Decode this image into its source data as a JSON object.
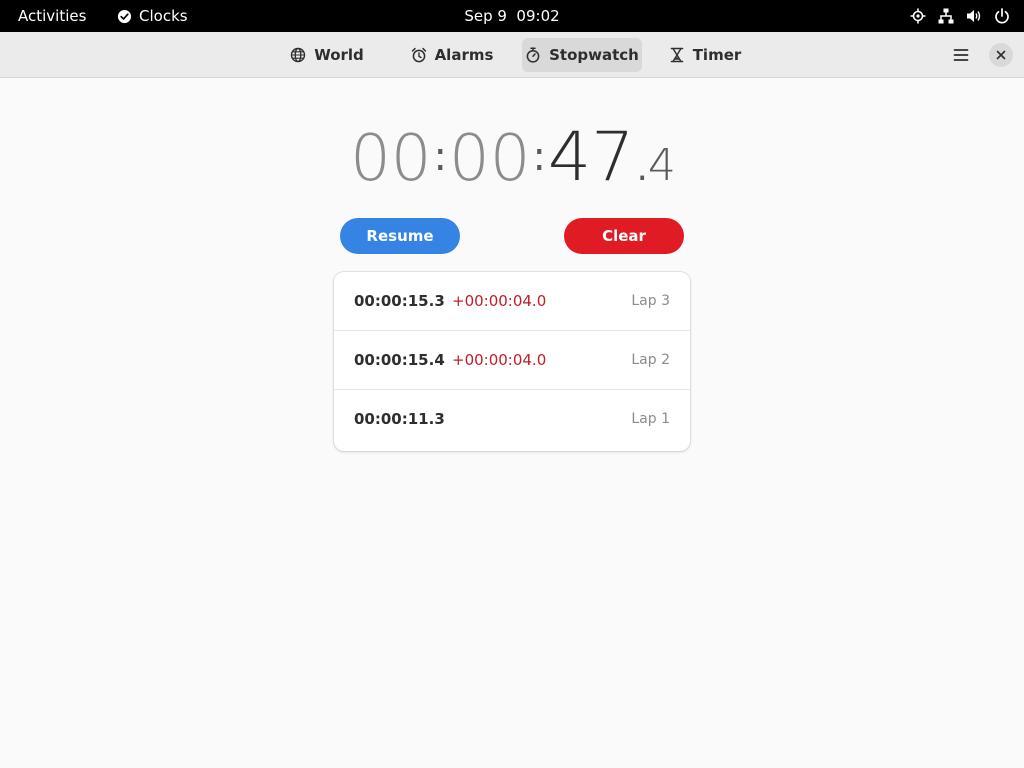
{
  "topbar": {
    "activities": "Activities",
    "app_name": "Clocks",
    "datetime": "Sep 9  09:02",
    "icons": [
      "location-icon",
      "network-icon",
      "volume-icon",
      "power-icon"
    ]
  },
  "header": {
    "tabs": [
      {
        "label": "World",
        "icon": "globe-icon",
        "active": false
      },
      {
        "label": "Alarms",
        "icon": "alarm-clock-icon",
        "active": false
      },
      {
        "label": "Stopwatch",
        "icon": "stopwatch-icon",
        "active": true
      },
      {
        "label": "Timer",
        "icon": "hourglass-icon",
        "active": false
      }
    ],
    "menu_icon": "hamburger-menu-icon",
    "close_icon": "close-icon"
  },
  "stopwatch": {
    "hours": "00",
    "minutes": "00",
    "seconds": "47",
    "tenths": "4",
    "separator": ":",
    "decimal": "."
  },
  "buttons": {
    "resume": "Resume",
    "clear": "Clear"
  },
  "laps": [
    {
      "time": "00:00:15.3",
      "diff": "+00:00:04.0",
      "label": "Lap 3"
    },
    {
      "time": "00:00:15.4",
      "diff": "+00:00:04.0",
      "label": "Lap 2"
    },
    {
      "time": "00:00:11.3",
      "diff": "",
      "label": "Lap 1"
    }
  ],
  "colors": {
    "accent_blue": "#3584e4",
    "destructive_red": "#e01b24",
    "diff_red": "#c01c28",
    "topbar": "#000000",
    "header": "#ebebeb",
    "window_bg": "#fafafa"
  }
}
